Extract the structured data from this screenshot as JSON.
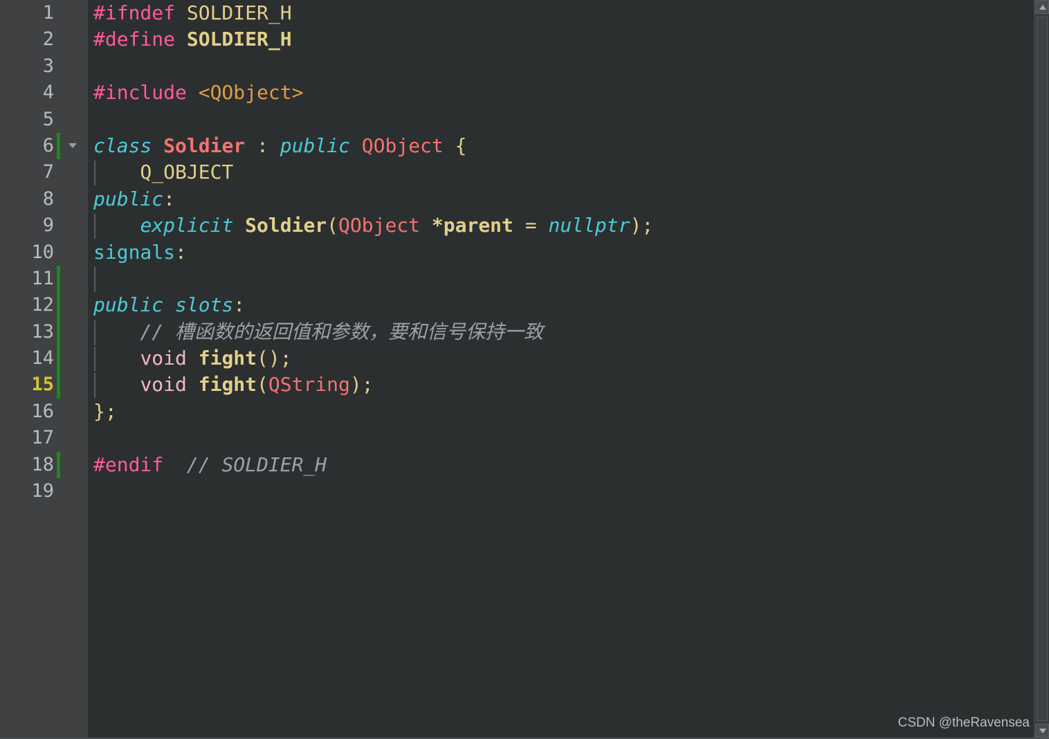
{
  "editor": {
    "language": "cpp",
    "current_line": 15,
    "first_visible_line": 1,
    "total_visible_lines": 19,
    "colors": {
      "gutter_bg": "#3f4143",
      "editor_bg": "#2c2f30",
      "line_number": "#b8bcc0",
      "current_line_number": "#d4c62e",
      "change_bar": "#1a8a1a",
      "preprocessor": "#ff5b9e",
      "keyword": "#4ec9d6",
      "type": "#f37372",
      "identifier": "#e2d08a",
      "include_path": "#e09b45",
      "comment": "#9ba1a6",
      "void_keyword": "#f5b8c0",
      "scrollbar_bg": "#3a3d3f"
    },
    "lines": [
      {
        "number": "1",
        "changed": false,
        "fold": false,
        "indent_guide": false,
        "tokens": [
          {
            "text": "#ifndef ",
            "cls": "t-pre"
          },
          {
            "text": "SOLDIER_H",
            "cls": "t-macro"
          }
        ]
      },
      {
        "number": "2",
        "changed": false,
        "fold": false,
        "indent_guide": false,
        "tokens": [
          {
            "text": "#define ",
            "cls": "t-pre"
          },
          {
            "text": "SOLDIER_H",
            "cls": "t-macro-b"
          }
        ]
      },
      {
        "number": "3",
        "changed": false,
        "fold": false,
        "indent_guide": false,
        "tokens": []
      },
      {
        "number": "4",
        "changed": false,
        "fold": false,
        "indent_guide": false,
        "tokens": [
          {
            "text": "#include ",
            "cls": "t-pre"
          },
          {
            "text": "<QObject>",
            "cls": "t-inc"
          }
        ]
      },
      {
        "number": "5",
        "changed": false,
        "fold": false,
        "indent_guide": false,
        "tokens": []
      },
      {
        "number": "6",
        "changed": true,
        "fold": true,
        "indent_guide": false,
        "tokens": [
          {
            "text": "class ",
            "cls": "t-kw"
          },
          {
            "text": "Soldier",
            "cls": "t-type-b"
          },
          {
            "text": " : ",
            "cls": "t-punct"
          },
          {
            "text": "public ",
            "cls": "t-kw"
          },
          {
            "text": "QObject",
            "cls": "t-type"
          },
          {
            "text": " {",
            "cls": "t-punct"
          }
        ]
      },
      {
        "number": "7",
        "changed": false,
        "fold": false,
        "indent_guide": true,
        "tokens": [
          {
            "text": "    Q_OBJECT",
            "cls": "t-macro"
          }
        ]
      },
      {
        "number": "8",
        "changed": false,
        "fold": false,
        "indent_guide": false,
        "tokens": [
          {
            "text": "public",
            "cls": "t-kw"
          },
          {
            "text": ":",
            "cls": "t-punct"
          }
        ]
      },
      {
        "number": "9",
        "changed": false,
        "fold": false,
        "indent_guide": true,
        "tokens": [
          {
            "text": "    ",
            "cls": "t-punct"
          },
          {
            "text": "explicit ",
            "cls": "t-kw"
          },
          {
            "text": "Soldier",
            "cls": "t-ident-b"
          },
          {
            "text": "(",
            "cls": "t-punct"
          },
          {
            "text": "QObject ",
            "cls": "t-type"
          },
          {
            "text": "*parent",
            "cls": "t-ident-b"
          },
          {
            "text": " = ",
            "cls": "t-punct"
          },
          {
            "text": "nullptr",
            "cls": "t-kw"
          },
          {
            "text": ");",
            "cls": "t-punct"
          }
        ]
      },
      {
        "number": "10",
        "changed": false,
        "fold": false,
        "indent_guide": false,
        "tokens": [
          {
            "text": "signals",
            "cls": "t-kw-p"
          },
          {
            "text": ":",
            "cls": "t-punct"
          }
        ]
      },
      {
        "number": "11",
        "changed": true,
        "fold": false,
        "indent_guide": true,
        "tokens": []
      },
      {
        "number": "12",
        "changed": true,
        "fold": false,
        "indent_guide": false,
        "tokens": [
          {
            "text": "public slots",
            "cls": "t-kw"
          },
          {
            "text": ":",
            "cls": "t-punct"
          }
        ]
      },
      {
        "number": "13",
        "changed": true,
        "fold": false,
        "indent_guide": true,
        "tokens": [
          {
            "text": "    ",
            "cls": "t-punct"
          },
          {
            "text": "// ",
            "cls": "t-comment"
          },
          {
            "text": "槽函数的返回值和参数，要和信号保持一致",
            "cls": "t-comment-cn"
          }
        ]
      },
      {
        "number": "14",
        "changed": true,
        "fold": false,
        "indent_guide": true,
        "tokens": [
          {
            "text": "    ",
            "cls": "t-punct"
          },
          {
            "text": "void ",
            "cls": "t-void"
          },
          {
            "text": "fight",
            "cls": "t-ident-b"
          },
          {
            "text": "();",
            "cls": "t-punct"
          }
        ]
      },
      {
        "number": "15",
        "changed": true,
        "fold": false,
        "indent_guide": true,
        "current": true,
        "tokens": [
          {
            "text": "    ",
            "cls": "t-punct"
          },
          {
            "text": "void ",
            "cls": "t-void"
          },
          {
            "text": "fight",
            "cls": "t-ident-b"
          },
          {
            "text": "(",
            "cls": "t-punct"
          },
          {
            "text": "QString",
            "cls": "t-type"
          },
          {
            "text": ");",
            "cls": "t-punct"
          }
        ]
      },
      {
        "number": "16",
        "changed": false,
        "fold": false,
        "indent_guide": false,
        "tokens": [
          {
            "text": "};",
            "cls": "t-punct"
          }
        ]
      },
      {
        "number": "17",
        "changed": false,
        "fold": false,
        "indent_guide": false,
        "tokens": []
      },
      {
        "number": "18",
        "changed": true,
        "fold": false,
        "indent_guide": false,
        "tokens": [
          {
            "text": "#endif",
            "cls": "t-pre"
          },
          {
            "text": "  // SOLDIER_H",
            "cls": "t-comment"
          }
        ]
      },
      {
        "number": "19",
        "changed": false,
        "fold": false,
        "indent_guide": false,
        "tokens": []
      }
    ]
  },
  "scrollbar": {
    "up_arrow": "scroll-up-arrow",
    "down_arrow": "scroll-down-arrow",
    "thumb": "scroll-thumb"
  },
  "watermark": {
    "text": "CSDN @theRavensea"
  }
}
